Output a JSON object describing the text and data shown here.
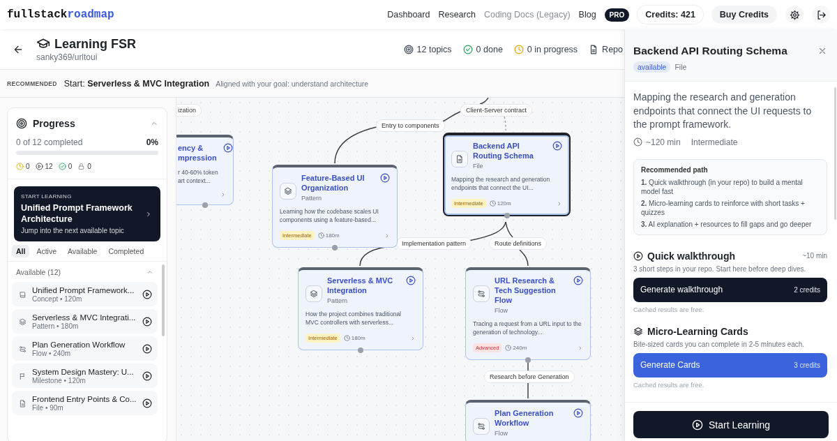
{
  "nav": {
    "logo": {
      "text": "fullstack",
      "accent": "roadmap"
    },
    "links": [
      {
        "label": "Dashboard",
        "disabled": false
      },
      {
        "label": "Research",
        "disabled": false
      },
      {
        "label": "Coding Docs (Legacy)",
        "disabled": true
      },
      {
        "label": "Blog",
        "disabled": false
      }
    ],
    "plan_badge": "PRO",
    "credits": "Credits: 421",
    "buy_button": "Buy Credits"
  },
  "header": {
    "title": "Learning FSR",
    "repo": "sanky369/urltoui",
    "stats": [
      {
        "kind": "topics",
        "label": "12 topics"
      },
      {
        "kind": "done",
        "label": "0 done"
      },
      {
        "kind": "progress",
        "label": "0 in progress"
      },
      {
        "kind": "repo",
        "label": "Repo"
      }
    ]
  },
  "recommended": {
    "label": "RECOMMENDED",
    "text": "Start: **Serverless & MVC Integration**",
    "note": "Aligned with your goal: understand architecture"
  },
  "sidebar": {
    "progress": {
      "title": "Progress",
      "expanded": true,
      "summary": "0 of 12 completed",
      "percent": "0%",
      "level": 0,
      "counts": [
        {
          "kind": "in_progress",
          "value": "0"
        },
        {
          "kind": "available",
          "value": "12"
        },
        {
          "kind": "done",
          "value": "0"
        },
        {
          "kind": "locked",
          "value": "0"
        }
      ]
    },
    "start_card": {
      "eyebrow": "START LEARNING",
      "title": "Unified Prompt Framework Architecture",
      "subtitle": "Jump into the next available topic"
    },
    "filters": [
      {
        "label": "All",
        "selected": true
      },
      {
        "label": "Active",
        "selected": false
      },
      {
        "label": "Available",
        "selected": false
      },
      {
        "label": "Completed",
        "selected": false
      }
    ],
    "group": {
      "title": "Available (12)",
      "expanded": true,
      "items": [
        {
          "kind": "concept",
          "title": "Unified Prompt Framework...",
          "meta": "Concept • 120m"
        },
        {
          "kind": "pattern",
          "title": "Serverless & MVC Integrati...",
          "meta": "Pattern • 180m"
        },
        {
          "kind": "flow",
          "title": "Plan Generation Workflow",
          "meta": "Flow • 240m"
        },
        {
          "kind": "milestone",
          "title": "System Design Mastery: U...",
          "meta": "Milestone • 120m"
        },
        {
          "kind": "file",
          "title": "Frontend Entry Points & Co...",
          "meta": "File • 90m"
        }
      ]
    }
  },
  "canvas": {
    "nodes": [
      {
        "kind": "partial",
        "title": "ency & mpression",
        "description": "r 40-60% token art context...",
        "selected": false
      },
      {
        "kind": "pattern",
        "title": "Feature-Based UI Organization",
        "type": "Pattern",
        "description": "Learning how the codebase scales UI components using a feature-based...",
        "difficulty": "Intermediate",
        "advanced": false,
        "duration": "180m",
        "selected": false
      },
      {
        "kind": "file",
        "title": "Backend API Routing Schema",
        "type": "File",
        "description": "Mapping the research and generation endpoints that connect the UI...",
        "difficulty": "Intermediate",
        "advanced": false,
        "duration": "120m",
        "selected": true
      },
      {
        "kind": "pattern",
        "title": "Serverless & MVC Integration",
        "type": "Pattern",
        "description": "How the project combines traditional MVC controllers with serverless...",
        "difficulty": "Intermediate",
        "advanced": false,
        "duration": "180m",
        "selected": false
      },
      {
        "kind": "flow",
        "title": "URL Research & Tech Suggestion Flow",
        "type": "Flow",
        "description": "Tracing a request from a URL input to the generation of technology...",
        "difficulty": "Advanced",
        "advanced": true,
        "duration": "240m",
        "selected": false
      },
      {
        "kind": "flow",
        "title": "Plan Generation Workflow",
        "type": "Flow",
        "selected": false
      }
    ],
    "edge_labels": [
      "ization",
      "Client-Server contract",
      "Entry to components",
      "Implementation pattern",
      "Route definitions",
      "Research before Generation"
    ]
  },
  "detail": {
    "title": "Backend API Routing Schema",
    "status": "available",
    "type": "File",
    "description": "Mapping the research and generation endpoints that connect the UI requests to the prompt framework.",
    "duration": "~120 min",
    "difficulty": "Intermediate",
    "path": {
      "title": "Recommended path",
      "steps": [
        "**1.** Quick walkthrough (in your repo) to build a mental model fast",
        "**2.** Micro-learning cards to reinforce with short tasks + quizzes",
        "**3.** AI explanation + resources to fill gaps and go deeper"
      ]
    },
    "sections": [
      {
        "kind": "walkthrough",
        "title": "Quick walkthrough",
        "time": "~10 min",
        "subtitle": "3 short steps in your repo. Start here before deep dives.",
        "button": "Generate walkthrough",
        "cost": "2 credits",
        "note": "Cached results are free."
      },
      {
        "kind": "cards",
        "title": "Micro-Learning Cards",
        "subtitle": "Bite-sized cards you can complete in 2-5 minutes each.",
        "button": "Generate Cards",
        "cost": "3 credits",
        "note": "Cached results are free."
      }
    ],
    "start_button": "Start Learning"
  }
}
